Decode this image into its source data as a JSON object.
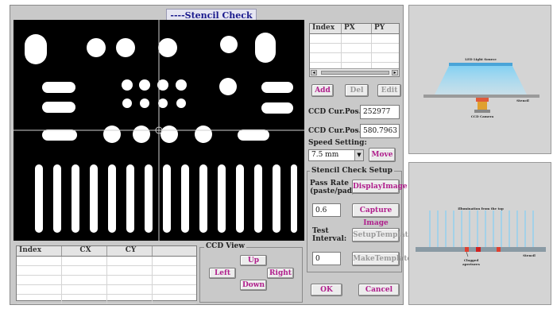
{
  "dialog": {
    "title": "----Stencil Check"
  },
  "index_grid": {
    "headers": [
      "Index",
      "PX",
      "PY"
    ]
  },
  "grid_buttons": {
    "add": "Add",
    "del": "Del",
    "edit": "Edit"
  },
  "ccd_pos": {
    "x_label": "CCD Cur.Pos.X:",
    "x_value": "252977",
    "y_label": "CCD Cur.Pos.Y:",
    "y_value": "580.7963"
  },
  "speed": {
    "label": "Speed Setting:",
    "value": "7.5 mm",
    "move": "Move"
  },
  "setup": {
    "group_label": "Stencil Check Setup",
    "pass_rate_label_1": "Pass Rate",
    "pass_rate_label_2": "(paste/pad) :",
    "pass_rate_value": "0.6",
    "test_interval_label_1": "Test",
    "test_interval_label_2": "Interval:",
    "test_interval_value": "0",
    "display_image": "DisplayImage",
    "capture_image": "Capture Image",
    "setup_template": "SetupTemplate",
    "make_template": "MakeTemplate"
  },
  "bottom_grid": {
    "headers": [
      "Index",
      "CX",
      "CY"
    ]
  },
  "ccd_view": {
    "label": "CCD View",
    "up": "Up",
    "down": "Down",
    "left": "Left",
    "right": "Right"
  },
  "dialog_buttons": {
    "ok": "OK",
    "cancel": "Cancel"
  },
  "diagram_top": {
    "source_label": "LED Light Source",
    "stencil_label": "Stencil",
    "camera_label": "CCD Camera"
  },
  "diagram_bottom": {
    "title": "Illumination from the top",
    "stencil_label": "Stencil",
    "clogged_label_1": "Clogged",
    "clogged_label_2": "apertures"
  },
  "colors": {
    "accent_text": "#b01e8c",
    "title_text": "#1a1a8c",
    "dialog_bg": "#c9c9c9",
    "light_blue": "#8fd0f0"
  }
}
